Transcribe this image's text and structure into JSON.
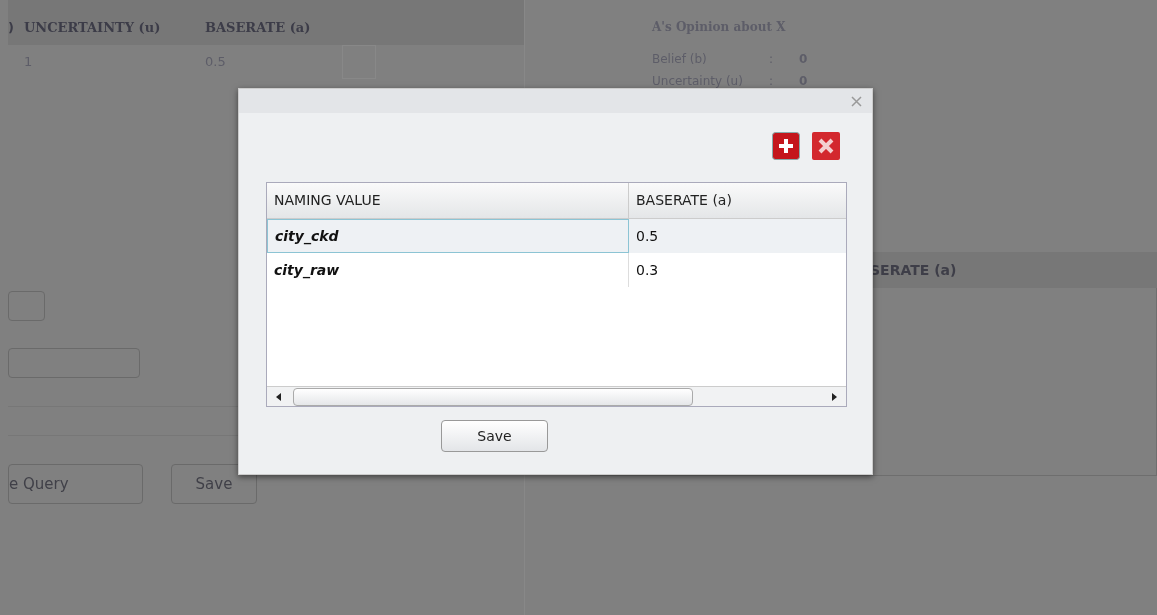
{
  "background": {
    "left_table": {
      "columns": [
        ")",
        "UNCERTAINTY (u)",
        "BASERATE (a)"
      ],
      "rows": [
        [
          "",
          "1",
          "0.5"
        ]
      ]
    },
    "left_controls": {
      "buttons": [
        "e Query",
        "Save"
      ]
    },
    "opinion_panel": {
      "title": "A's Opinion about X",
      "rows": [
        {
          "label": "Belief (b)",
          "separator": ":",
          "value": "0"
        },
        {
          "label": "Uncertainty (u)",
          "separator": ":",
          "value": "0"
        }
      ]
    },
    "right_table": {
      "columns": [
        "SERATE (a)"
      ]
    }
  },
  "dialog": {
    "table": {
      "columns": [
        "NAMING VALUE",
        "BASERATE (a)"
      ],
      "rows": [
        {
          "name": "city_ckd",
          "baserate": "0.5",
          "selected": true
        },
        {
          "name": "city_raw",
          "baserate": "0.3",
          "selected": false
        }
      ]
    },
    "save_button": "Save"
  }
}
